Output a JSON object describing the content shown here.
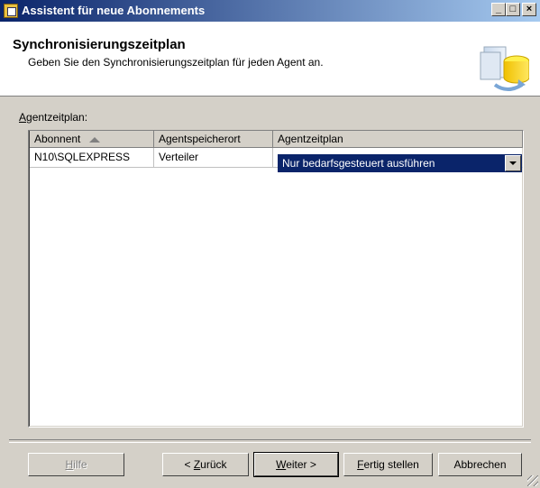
{
  "window": {
    "title": "Assistent für neue Abonnements",
    "controls": {
      "minimize": "_",
      "maximize": "□",
      "close": "×"
    }
  },
  "header": {
    "title": "Synchronisierungszeitplan",
    "subtitle": "Geben Sie den Synchronisierungszeitplan für jeden Agent an."
  },
  "section": {
    "label_accel": "A",
    "label_rest": "gentzeitplan:"
  },
  "grid": {
    "columns": [
      "Abonnent",
      "Agentspeicherort",
      "Agentzeitplan"
    ],
    "sorted_column": "Abonnent",
    "sort_direction": "ascending",
    "rows": [
      {
        "subscriber": "N10\\SQLEXPRESS",
        "location": "Verteiler",
        "schedule": "Nur bedarfsgesteuert ausführen"
      }
    ]
  },
  "buttons": {
    "help": {
      "accel": "H",
      "rest": "ilfe",
      "enabled": false
    },
    "back": {
      "pre": "< ",
      "accel": "Z",
      "rest": "urück"
    },
    "next": {
      "accel": "W",
      "rest": "eiter >"
    },
    "finish": {
      "accel": "F",
      "rest": "ertig stellen"
    },
    "cancel": {
      "label": "Abbrechen"
    }
  },
  "colors": {
    "titlebar_start": "#0a246a",
    "titlebar_end": "#a6caf0",
    "selection": "#0a246a",
    "face": "#d4d0c8"
  },
  "icons": [
    "wizard-app-icon",
    "minimize-icon",
    "maximize-icon",
    "close-icon",
    "database-sync-icon",
    "sort-ascending-icon",
    "dropdown-arrow-icon",
    "resize-grip-icon"
  ]
}
